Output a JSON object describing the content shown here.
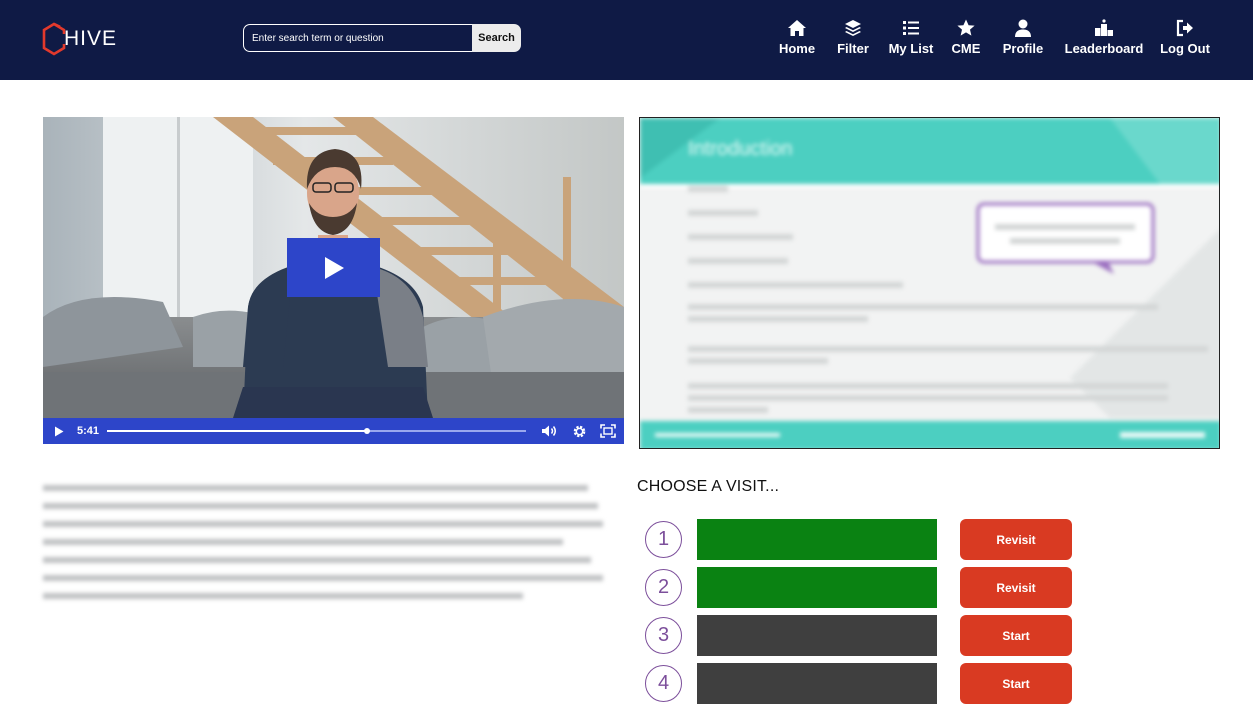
{
  "header": {
    "logo_text": "HIVE",
    "search": {
      "placeholder": "Enter search term or question",
      "button_label": "Search"
    },
    "nav": [
      {
        "label": "Home",
        "icon": "home-icon"
      },
      {
        "label": "Filter",
        "icon": "layers-icon"
      },
      {
        "label": "My List",
        "icon": "list-icon"
      },
      {
        "label": "CME",
        "icon": "star-icon"
      },
      {
        "label": "Profile",
        "icon": "user-icon"
      },
      {
        "label": "Leaderboard",
        "icon": "podium-icon"
      },
      {
        "label": "Log Out",
        "icon": "logout-icon"
      }
    ]
  },
  "video": {
    "current_time": "5:41",
    "progress": 0.62,
    "icons": [
      "play-icon",
      "volume-icon",
      "settings-icon",
      "fullscreen-icon"
    ]
  },
  "slide": {
    "title": "Introduction"
  },
  "visits": {
    "heading": "CHOOSE A VISIT...",
    "items": [
      {
        "number": "1",
        "status_color": "#0a8212",
        "button_label": "Revisit"
      },
      {
        "number": "2",
        "status_color": "#0a8212",
        "button_label": "Revisit"
      },
      {
        "number": "3",
        "status_color": "#3f3f3f",
        "button_label": "Start"
      },
      {
        "number": "4",
        "status_color": "#3f3f3f",
        "button_label": "Start"
      }
    ]
  },
  "colors": {
    "header_bg": "#0f1a45",
    "accent_blue": "#2d45c9",
    "button_red": "#d93a22",
    "complete_green": "#0a8212",
    "pending_gray": "#3f3f3f",
    "number_purple": "#7c4f9b",
    "slide_teal": "#4ccfc1"
  }
}
